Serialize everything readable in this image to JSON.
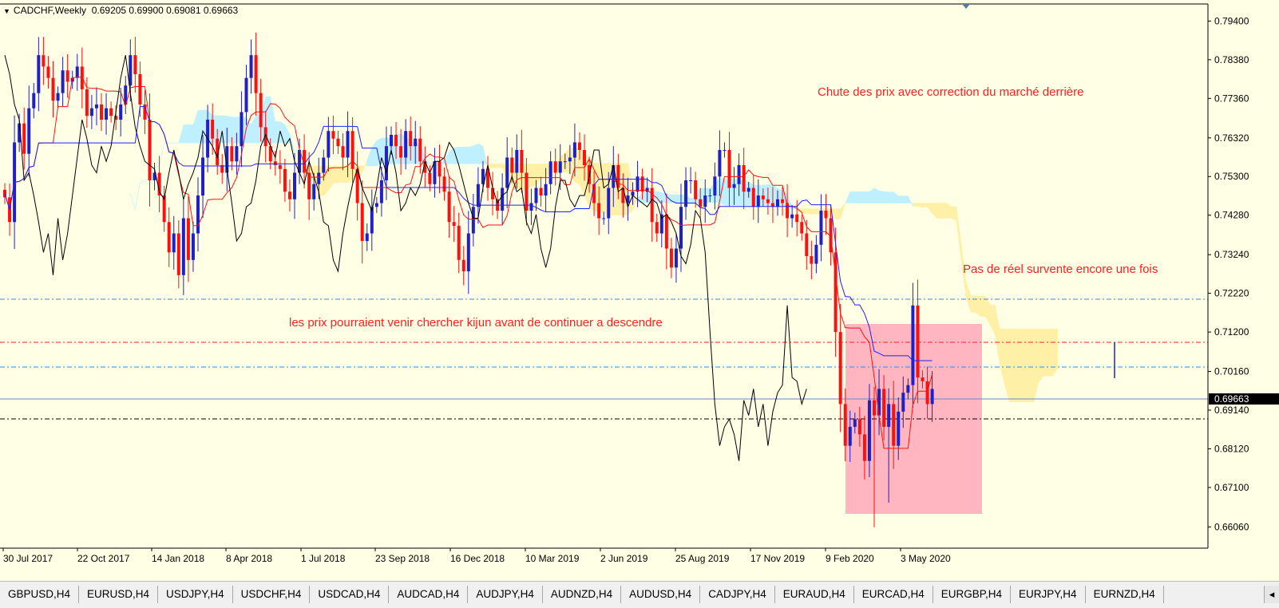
{
  "header": {
    "symbol": "CADCHF,Weekly",
    "ohlc": "0.69205 0.69900 0.69081 0.69663"
  },
  "annotations": {
    "top_right": "Chute des prix avec correction du marché derrière",
    "middle_right": "Pas de réel survente encore une fois",
    "middle_left": "les prix pourraient venir chercher kijun avant de continuer  a descendre"
  },
  "colors": {
    "background": "#ffffe5",
    "bull": "#2020c8",
    "bear": "#ff1010",
    "tenkan": "#ff1010",
    "kijun": "#2020ff",
    "chikou": "#000000",
    "cloud_bull": "#bff0ff",
    "cloud_bear": "#fff0a8",
    "zone": "#ffb6c1"
  },
  "chart_data": {
    "type": "candlestick",
    "instrument": "CADCHF",
    "timeframe": "Weekly",
    "ylim": [
      0.655,
      0.7985
    ],
    "y_ticks": [
      "0.79400",
      "0.78380",
      "0.77360",
      "0.76320",
      "0.75300",
      "0.74280",
      "0.73240",
      "0.72220",
      "0.71200",
      "0.70160",
      "0.69140",
      "0.68120",
      "0.67100",
      "0.66060"
    ],
    "current_price": "0.69663",
    "x_ticks": [
      "30 Jul 2017",
      "22 Oct 2017",
      "14 Jan 2018",
      "8 Apr 2018",
      "1 Jul 2018",
      "23 Sep 2018",
      "16 Dec 2018",
      "10 Mar 2019",
      "2 Jun 2019",
      "25 Aug 2019",
      "17 Nov 2019",
      "9 Feb 2020",
      "3 May 2020"
    ],
    "closes": [
      0.7475,
      0.741,
      0.762,
      0.767,
      0.759,
      0.771,
      0.775,
      0.785,
      0.782,
      0.779,
      0.773,
      0.775,
      0.781,
      0.778,
      0.779,
      0.782,
      0.776,
      0.769,
      0.771,
      0.772,
      0.768,
      0.771,
      0.769,
      0.768,
      0.772,
      0.777,
      0.785,
      0.78,
      0.772,
      0.768,
      0.752,
      0.754,
      0.748,
      0.741,
      0.733,
      0.738,
      0.727,
      0.742,
      0.731,
      0.738,
      0.748,
      0.758,
      0.768,
      0.763,
      0.756,
      0.754,
      0.761,
      0.757,
      0.761,
      0.77,
      0.779,
      0.785,
      0.775,
      0.766,
      0.761,
      0.757,
      0.756,
      0.755,
      0.749,
      0.747,
      0.754,
      0.76,
      0.754,
      0.747,
      0.751,
      0.754,
      0.758,
      0.765,
      0.763,
      0.761,
      0.758,
      0.765,
      0.755,
      0.746,
      0.736,
      0.738,
      0.745,
      0.746,
      0.752,
      0.761,
      0.764,
      0.761,
      0.758,
      0.765,
      0.761,
      0.763,
      0.757,
      0.754,
      0.751,
      0.757,
      0.753,
      0.749,
      0.741,
      0.74,
      0.731,
      0.728,
      0.738,
      0.745,
      0.751,
      0.755,
      0.75,
      0.747,
      0.744,
      0.75,
      0.758,
      0.754,
      0.76,
      0.754,
      0.744,
      0.746,
      0.75,
      0.748,
      0.751,
      0.757,
      0.754,
      0.757,
      0.757,
      0.758,
      0.762,
      0.76,
      0.756,
      0.751,
      0.746,
      0.742,
      0.742,
      0.75,
      0.756,
      0.75,
      0.746,
      0.748,
      0.749,
      0.753,
      0.749,
      0.75,
      0.741,
      0.738,
      0.743,
      0.734,
      0.729,
      0.734,
      0.745,
      0.752,
      0.752,
      0.747,
      0.745,
      0.748,
      0.748,
      0.753,
      0.76,
      0.76,
      0.75,
      0.751,
      0.756,
      0.749,
      0.75,
      0.745,
      0.748,
      0.747,
      0.746,
      0.745,
      0.747,
      0.746,
      0.742,
      0.743,
      0.741,
      0.738,
      0.732,
      0.73,
      0.735,
      0.744,
      0.742,
      0.733,
      0.712,
      0.693,
      0.682,
      0.687,
      0.689,
      0.685,
      0.678,
      0.694,
      0.69,
      0.697,
      0.687,
      0.693,
      0.682,
      0.691,
      0.696,
      0.698,
      0.719,
      0.7,
      0.699,
      0.693,
      0.697
    ]
  }
}
